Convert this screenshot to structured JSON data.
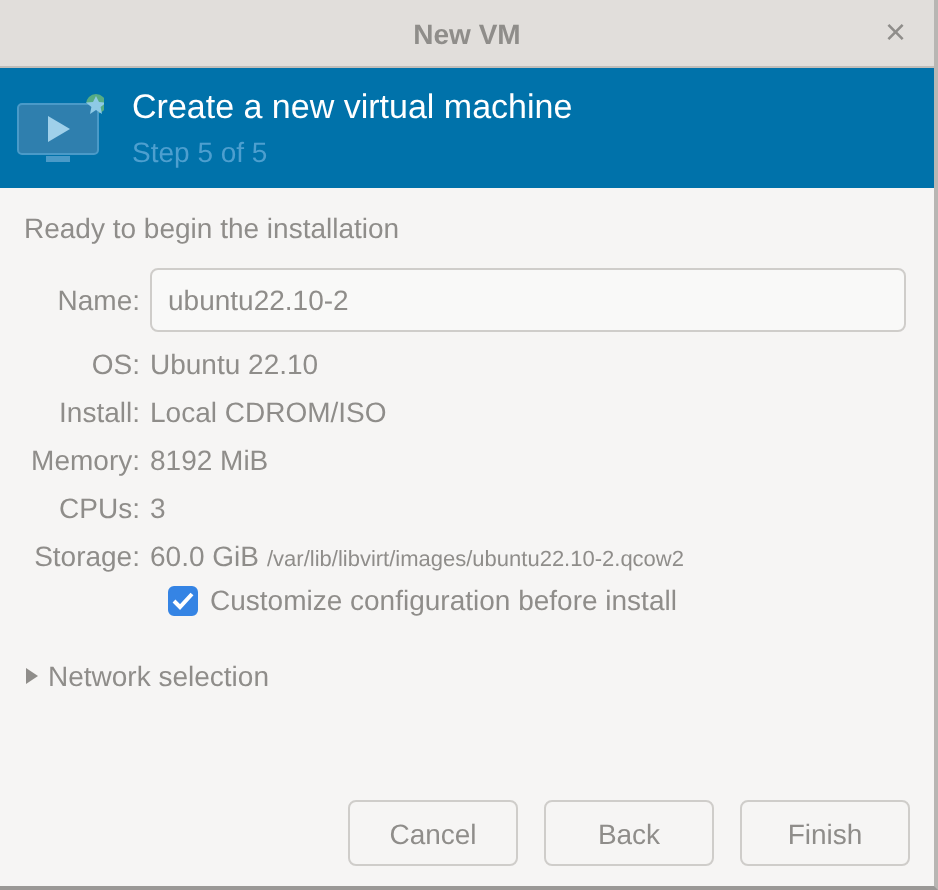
{
  "window": {
    "title": "New VM",
    "close": "×"
  },
  "banner": {
    "title": "Create a new virtual machine",
    "subtitle": "Step 5 of 5"
  },
  "heading": "Ready to begin the installation",
  "name_field": {
    "label": "Name:",
    "value": "ubuntu22.10-2"
  },
  "details": [
    {
      "label": "OS:",
      "value": "Ubuntu 22.10"
    },
    {
      "label": "Install:",
      "value": "Local CDROM/ISO"
    },
    {
      "label": "Memory:",
      "value": "8192 MiB"
    },
    {
      "label": "CPUs:",
      "value": "3"
    },
    {
      "label": "Storage:",
      "value": "60.0 GiB",
      "path": "/var/lib/libvirt/images/ubuntu22.10-2.qcow2"
    }
  ],
  "customize": {
    "label": "Customize configuration before install",
    "checked": true
  },
  "network": {
    "label": "Network selection",
    "expanded": false
  },
  "buttons": [
    "Cancel",
    "Back",
    "Finish"
  ]
}
